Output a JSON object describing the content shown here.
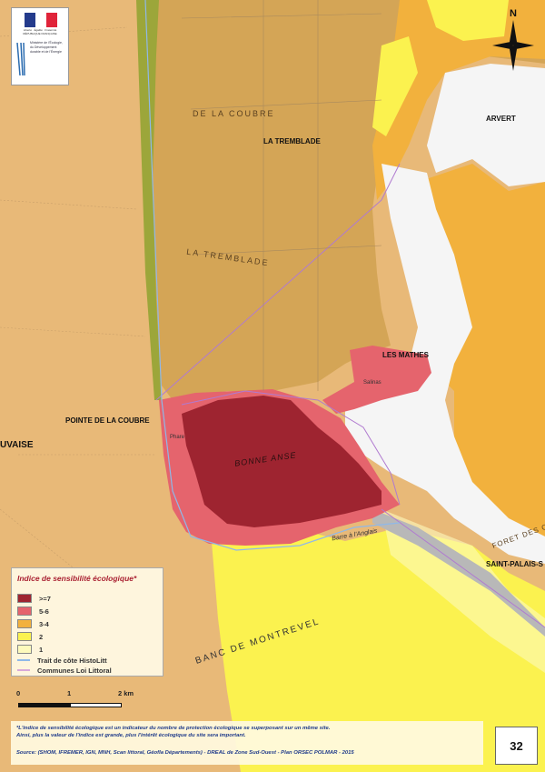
{
  "logo": {
    "republic_text": "Liberté · Égalité · Fraternité RÉPUBLIQUE FRANÇAISE",
    "ministry_text": "Ministère de l'Écologie, du Développement durable et de l'Énergie"
  },
  "map": {
    "compass_label": "N",
    "places": {
      "arvert": "ARVERT",
      "la_tremblade": "LA TREMBLADE",
      "les_mathes": "LES MATHES",
      "pointe_de_la_coubre": "POINTE DE LA COUBRE",
      "saint_palais": "SAINT-PALAIS-S",
      "bonne_anse": "BONNE ANSE",
      "banc_de_montrevel": "BANC DE MONTREVEL",
      "uvaise": "UVAISE",
      "foret_coubre": "DE LA COUBRE",
      "la_tremblade_foret": "LA TREMBLADE",
      "foret_des_co": "FORET DES CO",
      "barre_anglais": "Barre à l'Anglais",
      "phare": "Phare",
      "salinas": "Salinas"
    },
    "colors": {
      "sea": "#e8b978",
      "forest": "#d4a556",
      "orange_zone": "#f2b13d",
      "yellow_zone": "#fbf24f",
      "pink_zone": "#e5646d",
      "dark_red_zone": "#9e2430",
      "urban": "#f5f5f5",
      "dune_green": "#9ca63a"
    }
  },
  "legend": {
    "title": "Indice de sensibilité écologique*",
    "items": [
      {
        "label": ">=7",
        "color": "#9e2430"
      },
      {
        "label": "5-6",
        "color": "#e5646d"
      },
      {
        "label": "3-4",
        "color": "#f2b13d"
      },
      {
        "label": "2",
        "color": "#fbf24f"
      },
      {
        "label": "1",
        "color": "#fdfabc"
      }
    ],
    "lines": [
      {
        "label": "Trait de côte HistoLitt",
        "color": "#8fb8e8"
      },
      {
        "label": "Communes Loi Littoral",
        "color": "#d8a8d8"
      }
    ]
  },
  "scale": {
    "labels": [
      "0",
      "1",
      "2 km"
    ]
  },
  "footer": {
    "note_line1": "*L'indice de sensibilité écologique est un indicateur du nombre de protection écologique se superposant sur un même site.",
    "note_line2": "Ainsi, plus la valeur de l'indice est grande, plus l'intérêt écologique du site sera important.",
    "source": "Source: (SHOM, IFREMER, IGN, MNH, Scan littoral, Géofla Départements) - DREAL de Zone Sud-Ouest - Plan ORSEC POLMAR - 2015"
  },
  "page_number": "32"
}
